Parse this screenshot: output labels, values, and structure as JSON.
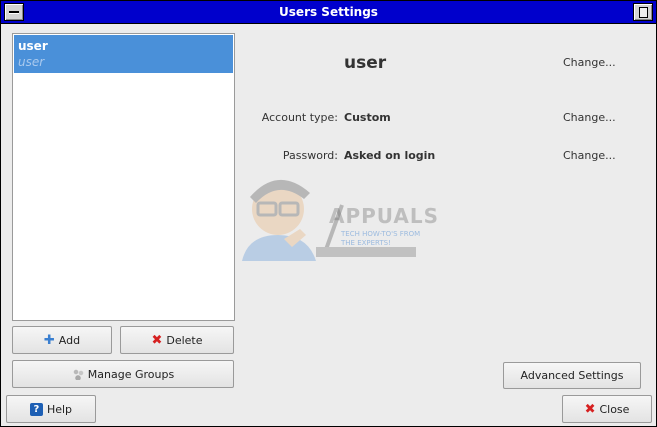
{
  "window": {
    "title": "Users Settings"
  },
  "users": [
    {
      "name": "user",
      "subtitle": "user"
    }
  ],
  "list_buttons": {
    "add_label": "Add",
    "delete_label": "Delete",
    "manage_groups_label": "Manage Groups"
  },
  "details": {
    "username": "user",
    "account_type_label": "Account type:",
    "account_type_value": "Custom",
    "password_label": "Password:",
    "password_value": "Asked on login",
    "change_label": "Change..."
  },
  "watermark": {
    "brand": "APPUALS",
    "tagline": "TECH HOW-TO'S FROM THE EXPERTS!"
  },
  "footer": {
    "advanced_label": "Advanced Settings",
    "help_label": "Help",
    "close_label": "Close"
  },
  "icons": {
    "add": "plus-icon",
    "delete": "x-icon",
    "groups": "groups-icon",
    "help": "help-icon",
    "close": "close-icon"
  },
  "colors": {
    "titlebar": "#0000cc",
    "selection": "#4a90d9",
    "background": "#ececec"
  }
}
